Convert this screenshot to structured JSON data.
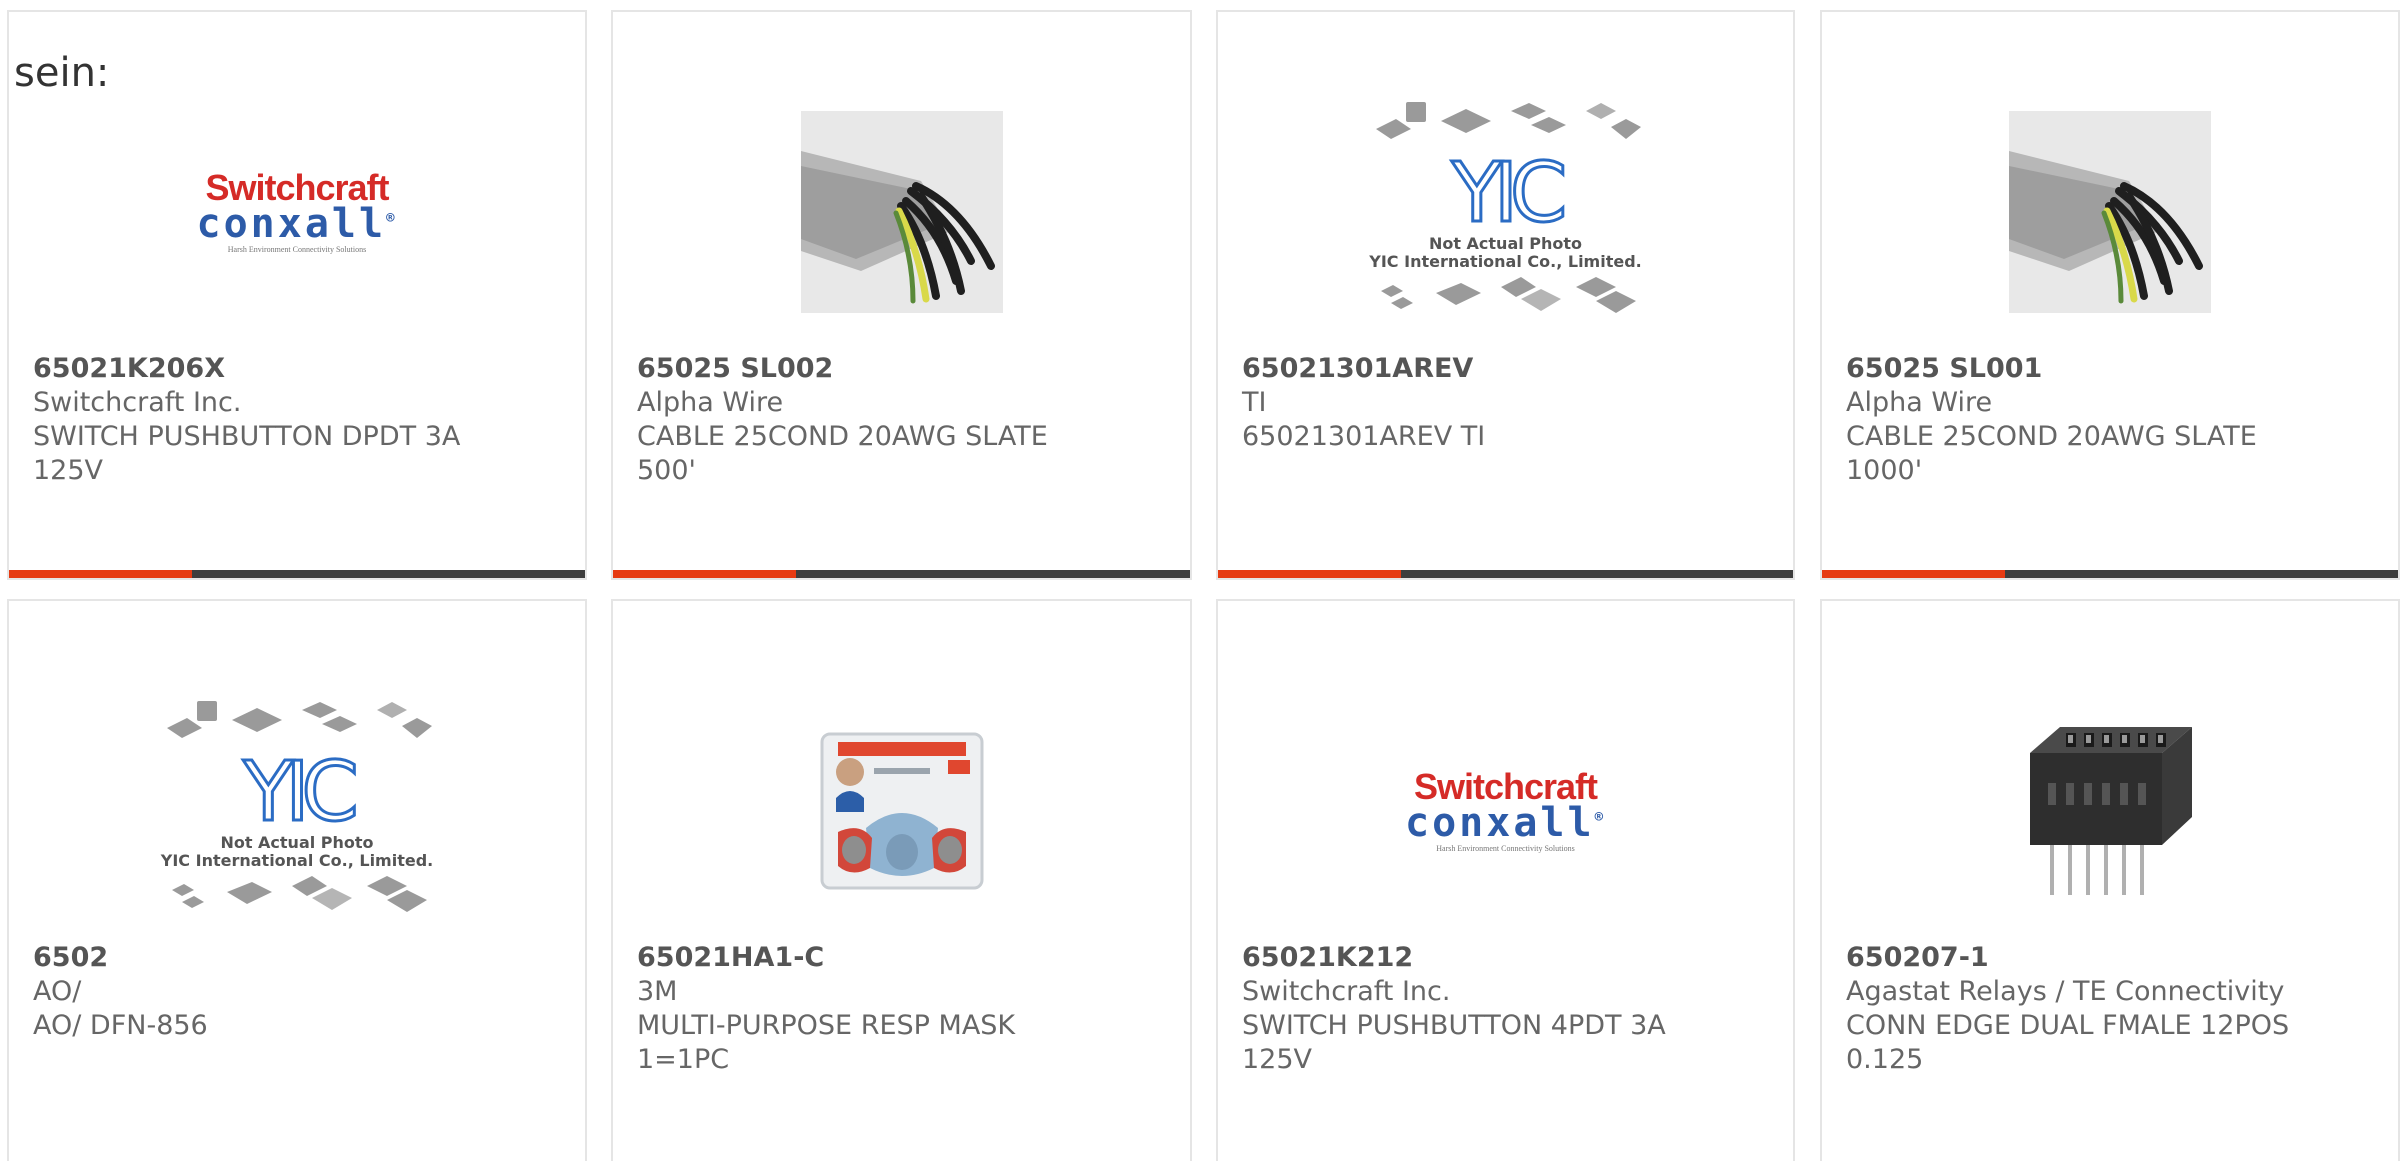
{
  "heading_fragment": "sein:",
  "placeholder": {
    "logo": "YIC",
    "line1": "Not Actual Photo",
    "line2": "YIC International Co., Limited."
  },
  "brand_logo": {
    "line1": "Switchcraft",
    "line2": "conxall",
    "reg": "®",
    "tagline": "Harsh Environment Connectivity Solutions"
  },
  "accent_colors": {
    "progress": "#e63a12",
    "track": "#3d3d3d"
  },
  "products": [
    {
      "part": "65021K206X",
      "manufacturer": "Switchcraft Inc.",
      "description": "SWITCH PUSHBUTTON DPDT 3A\n125V",
      "image": "switchcraft-logo"
    },
    {
      "part": "65025 SL002",
      "manufacturer": "Alpha Wire",
      "description": "CABLE 25COND 20AWG SLATE\n500'",
      "image": "cable-photo"
    },
    {
      "part": "65021301AREV",
      "manufacturer": "TI",
      "description": "65021301AREV TI",
      "image": "not-actual-photo"
    },
    {
      "part": "65025 SL001",
      "manufacturer": "Alpha Wire",
      "description": "CABLE 25COND 20AWG SLATE\n1000'",
      "image": "cable-photo"
    },
    {
      "part": "6502",
      "manufacturer": "AO/",
      "description": "AO/ DFN-856",
      "image": "not-actual-photo"
    },
    {
      "part": "65021HA1-C",
      "manufacturer": "3M",
      "description": "MULTI-PURPOSE RESP MASK\n1=1PC",
      "image": "respirator-photo"
    },
    {
      "part": "65021K212",
      "manufacturer": "Switchcraft Inc.",
      "description": "SWITCH PUSHBUTTON 4PDT 3A\n125V",
      "image": "switchcraft-logo"
    },
    {
      "part": "650207-1",
      "manufacturer": "Agastat Relays / TE Connectivity",
      "description": "CONN EDGE DUAL FMALE 12POS\n0.125",
      "image": "connector-photo"
    }
  ]
}
